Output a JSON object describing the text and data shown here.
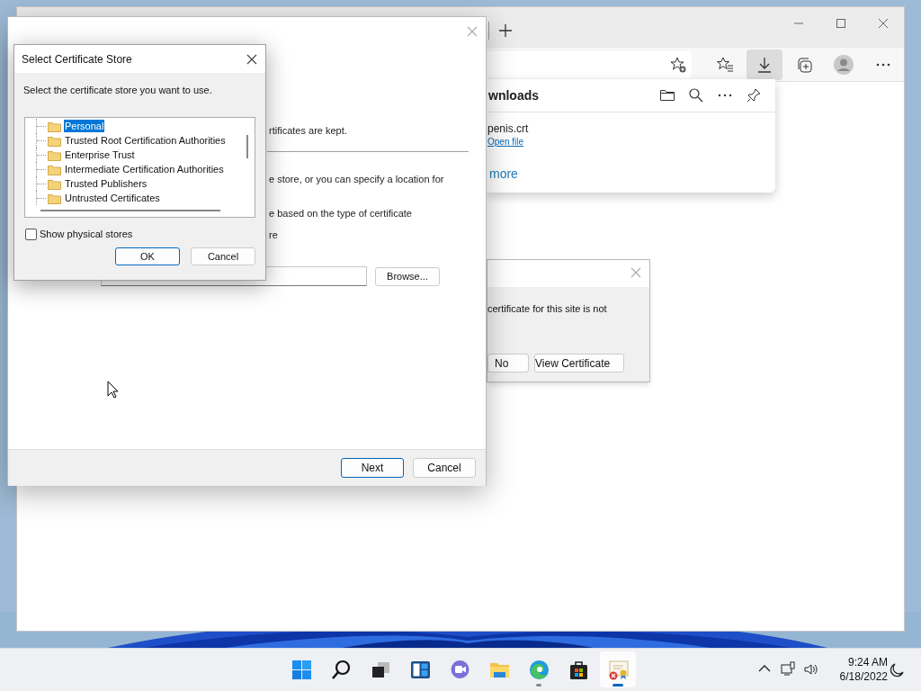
{
  "browser": {
    "toolbar_buttons": [
      {
        "kind": "favorite-add",
        "pressed": false
      },
      {
        "kind": "favorites",
        "pressed": false
      },
      {
        "kind": "downloads",
        "pressed": true
      },
      {
        "kind": "collections",
        "pressed": false
      },
      {
        "kind": "profile",
        "pressed": false
      },
      {
        "kind": "more",
        "pressed": false
      }
    ]
  },
  "downloads_flyout": {
    "title": "wnloads",
    "items": [
      {
        "file": "penis.crt",
        "action": "Open file"
      }
    ],
    "more_link": "more"
  },
  "security_dialog": {
    "message": "certificate for this site is not",
    "buttons": [
      {
        "label": "No"
      },
      {
        "label": "View Certificate"
      }
    ]
  },
  "wizard": {
    "lines": [
      "rtificates are kept.",
      "e store, or you can specify a location for",
      "e based on the type of certificate",
      "re"
    ],
    "browse_button": "Browse...",
    "buttons": [
      {
        "label": "Next",
        "default": true
      },
      {
        "label": "Cancel",
        "default": false
      }
    ]
  },
  "store_dialog": {
    "title": "Select Certificate Store",
    "prompt": "Select the certificate store you want to use.",
    "stores": [
      {
        "name": "Personal",
        "selected": true
      },
      {
        "name": "Trusted Root Certification Authorities",
        "selected": false
      },
      {
        "name": "Enterprise Trust",
        "selected": false
      },
      {
        "name": "Intermediate Certification Authorities",
        "selected": false
      },
      {
        "name": "Trusted Publishers",
        "selected": false
      },
      {
        "name": "Untrusted Certificates",
        "selected": false
      }
    ],
    "show_physical_stores": {
      "label": "Show physical stores",
      "checked": false
    },
    "buttons": [
      {
        "label": "OK",
        "default": true
      },
      {
        "label": "Cancel",
        "default": false
      }
    ]
  },
  "taskbar": {
    "apps": [
      {
        "kind": "start",
        "running": false,
        "active": false
      },
      {
        "kind": "search",
        "running": false,
        "active": false
      },
      {
        "kind": "task-view",
        "running": false,
        "active": false
      },
      {
        "kind": "widgets",
        "running": false,
        "active": false
      },
      {
        "kind": "chat",
        "running": false,
        "active": false
      },
      {
        "kind": "file-explorer",
        "running": false,
        "active": false
      },
      {
        "kind": "edge",
        "running": true,
        "active": false
      },
      {
        "kind": "store",
        "running": false,
        "active": false
      },
      {
        "kind": "certificate",
        "running": true,
        "active": true
      }
    ],
    "time": "9:24 AM",
    "date": "6/18/2022"
  }
}
